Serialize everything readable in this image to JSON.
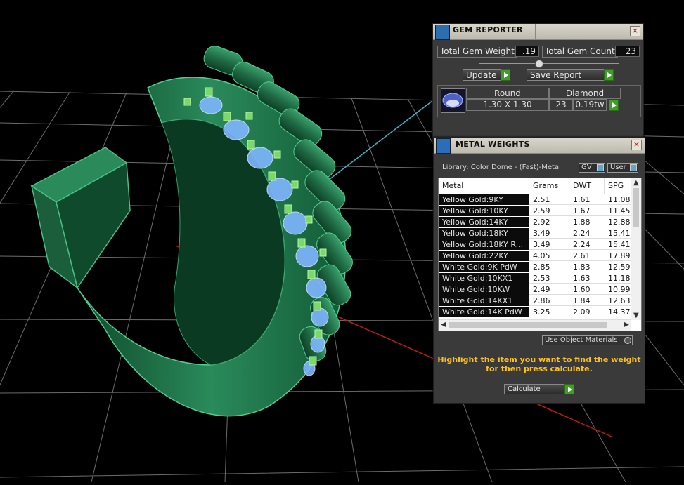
{
  "gem_reporter": {
    "title": "GEM REPORTER",
    "close": "×",
    "total_weight_label": "Total Gem Weight",
    "total_weight_value": ".19",
    "total_count_label": "Total Gem Count",
    "total_count_value": "23",
    "update_label": "Update",
    "save_report_label": "Save Report",
    "table": {
      "shape_header": "Round",
      "shape_value": "1.30 X 1.30",
      "material_header": "Diamond",
      "count": "23",
      "weight": "0.19tw"
    }
  },
  "metal_weights": {
    "title": "METAL WEIGHTS",
    "close": "×",
    "library": "Library: Color Dome - (Fast)-Metal",
    "gv_label": "GV",
    "user_label": "User",
    "columns": [
      "Metal",
      "Grams",
      "DWT",
      "SPG"
    ],
    "rows": [
      {
        "metal": "Yellow Gold:9KY",
        "grams": "2.51",
        "dwt": "1.61",
        "spg": "11.08"
      },
      {
        "metal": "Yellow Gold:10KY",
        "grams": "2.59",
        "dwt": "1.67",
        "spg": "11.45"
      },
      {
        "metal": "Yellow Gold:14KY",
        "grams": "2.92",
        "dwt": "1.88",
        "spg": "12.88"
      },
      {
        "metal": "Yellow Gold:18KY",
        "grams": "3.49",
        "dwt": "2.24",
        "spg": "15.41"
      },
      {
        "metal": "Yellow Gold:18KY R...",
        "grams": "3.49",
        "dwt": "2.24",
        "spg": "15.41"
      },
      {
        "metal": "Yellow Gold:22KY",
        "grams": "4.05",
        "dwt": "2.61",
        "spg": "17.89"
      },
      {
        "metal": "White Gold:9K PdW",
        "grams": "2.85",
        "dwt": "1.83",
        "spg": "12.59"
      },
      {
        "metal": "White Gold:10KX1",
        "grams": "2.53",
        "dwt": "1.63",
        "spg": "11.18"
      },
      {
        "metal": "White Gold:10KW",
        "grams": "2.49",
        "dwt": "1.60",
        "spg": "10.99"
      },
      {
        "metal": "White Gold:14KX1",
        "grams": "2.86",
        "dwt": "1.84",
        "spg": "12.63"
      },
      {
        "metal": "White Gold:14K PdW",
        "grams": "3.25",
        "dwt": "2.09",
        "spg": "14.37"
      }
    ],
    "use_object_materials": "Use Object Materials",
    "hint_line1": "Highlight the item you want to find the weight",
    "hint_line2": "for then press calculate.",
    "calculate_label": "Calculate"
  },
  "colors": {
    "ring_green": "#1f6b45",
    "prong_green": "#7bd96a",
    "gem_blue": "#7fb6ff",
    "grid": "#6c6c6c",
    "axis_red": "#c01818",
    "axis_cyan": "#37b6c9",
    "hint_yellow": "#ffc21a",
    "play_green": "#3f9e25"
  }
}
